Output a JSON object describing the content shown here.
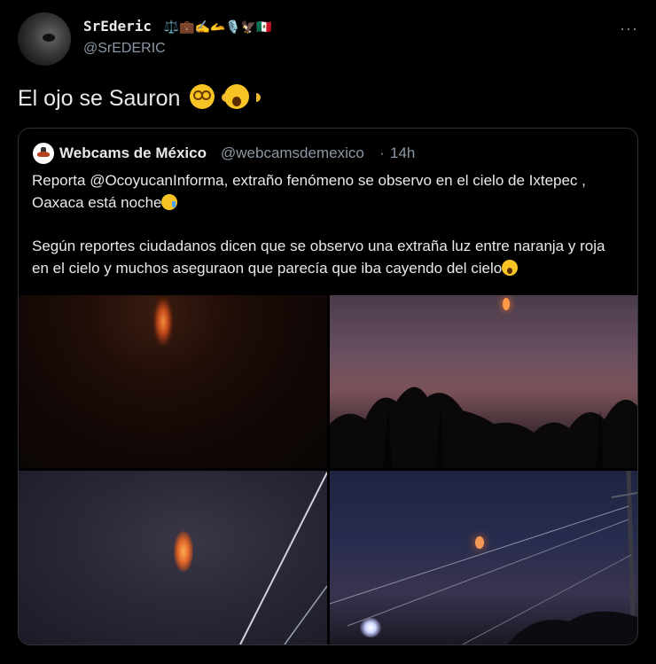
{
  "author": {
    "display_name": "SrEderic",
    "name_emojis": "⚖️💼✍️🫴🎙️🦅🇲🇽",
    "handle": "@SrEDERIC"
  },
  "tweet": {
    "text": "El ojo se Sauron",
    "emojis": [
      "dizzy-face",
      "screaming-face"
    ]
  },
  "more_label": "···",
  "quoted_tweet": {
    "display_name": "Webcams de México",
    "handle": "@webcamsdemexico",
    "separator": "·",
    "time": "14h",
    "paragraph_1": "Reporta @OcoyucanInforma, extraño fenómeno se observo en el cielo de Ixtepec , Oaxaca está noche",
    "paragraph_2": "Según reportes ciudadanos dicen que se observo una extraña luz entre naranja y roja en el cielo y muchos aseguraon que parecía que iba cayendo del cielo",
    "photos": [
      "photo-1",
      "photo-2",
      "photo-3",
      "photo-4"
    ]
  },
  "colors": {
    "background": "#000000",
    "text": "#e7e9ea",
    "muted": "#8b98a5",
    "border": "#2f3336"
  }
}
